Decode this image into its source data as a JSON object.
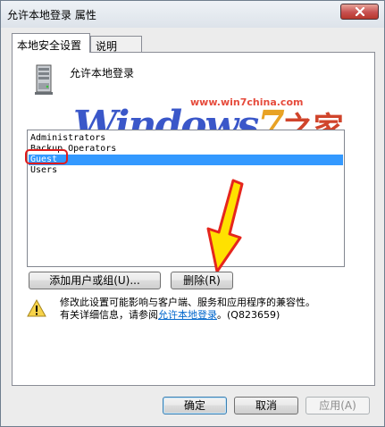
{
  "window": {
    "title": "允许本地登录 属性",
    "close_icon": "close-icon"
  },
  "tabs": [
    {
      "label": "本地安全设置"
    },
    {
      "label": "说明"
    }
  ],
  "policy": {
    "title": "允许本地登录",
    "icon": "server-icon"
  },
  "watermark": {
    "url": "www.win7china.com",
    "logo_main": "Windows",
    "logo_seven": "7",
    "logo_zh": "之家"
  },
  "list": {
    "items": [
      {
        "label": "Administrators"
      },
      {
        "label": "Backup Operators"
      },
      {
        "label": "Guest"
      },
      {
        "label": "Users"
      }
    ],
    "selected": "Guest"
  },
  "buttons": {
    "add": "添加用户或组(U)...",
    "remove": "删除(R)",
    "ok": "确定",
    "cancel": "取消",
    "apply": "应用(A)"
  },
  "warning": {
    "line1": "修改此设置可能影响与客户端、服务和应用程序的兼容性。",
    "line2_prefix": "有关详细信息，请参阅",
    "link": "允许本地登录",
    "line2_suffix": "。(Q823659)"
  },
  "colors": {
    "selection": "#3399ff",
    "annotation_red": "#e01b1b",
    "arrow_yellow": "#ffe100"
  }
}
